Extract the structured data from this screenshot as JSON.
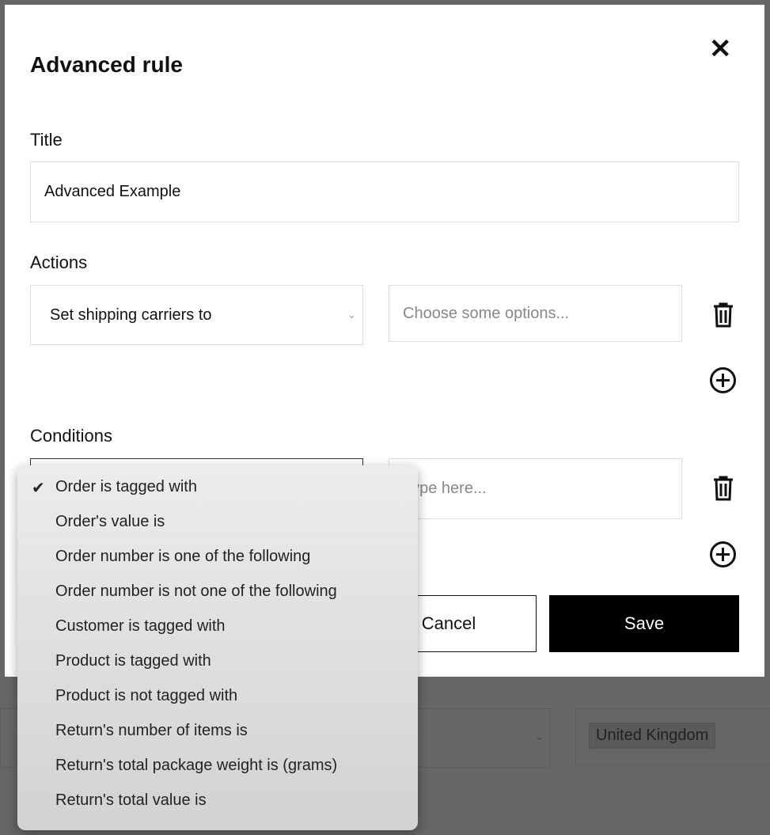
{
  "background": {
    "country_tag": "United Kingdom"
  },
  "modal": {
    "title": "Advanced rule",
    "title_label": "Title",
    "title_value": "Advanced Example",
    "actions_label": "Actions",
    "action_select": "Set shipping carriers to",
    "action_placeholder": "Choose some options...",
    "conditions_label": "Conditions",
    "condition_placeholder": "Type here...",
    "cancel": "Cancel",
    "save": "Save"
  },
  "dropdown": {
    "selected": "Order is tagged with",
    "options": [
      "Order is tagged with",
      "Order's value is",
      "Order number is one of the following",
      "Order number is not one of the following",
      "Customer is tagged with",
      "Product is tagged with",
      "Product is not tagged with",
      "Return's number of items is",
      "Return's total package weight is (grams)",
      "Return's total value is"
    ]
  }
}
